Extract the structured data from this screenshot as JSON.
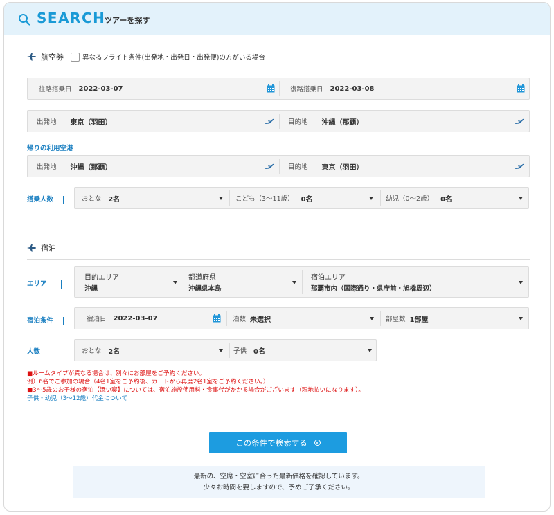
{
  "header": {
    "title": "SEARCH",
    "subtitle": "ツアーを探す"
  },
  "air": {
    "section_title": "航空券",
    "diff_flight_label": "異なるフライト条件(出発地・出発日・出発便)の方がいる場合",
    "outbound": {
      "label": "往路搭乗日",
      "value": "2022-03-07"
    },
    "inbound": {
      "label": "復路搭乗日",
      "value": "2022-03-08"
    },
    "depart": {
      "label": "出発地",
      "value": "東京（羽田）"
    },
    "dest": {
      "label": "目的地",
      "value": "沖縄（那覇）"
    },
    "return_airport_title": "帰りの利用空港",
    "ret_depart": {
      "label": "出発地",
      "value": "沖縄（那覇）"
    },
    "ret_dest": {
      "label": "目的地",
      "value": "東京（羽田）"
    },
    "pax_label": "搭乗人数",
    "adult": {
      "label": "おとな",
      "value": "2名"
    },
    "child": {
      "label": "こども（3〜11歳）",
      "value": "0名"
    },
    "infant": {
      "label": "幼児（0〜2歳）",
      "value": "0名"
    }
  },
  "hotel": {
    "section_title": "宿泊",
    "area_label": "エリア",
    "dest_area": {
      "label": "目的エリア",
      "value": "沖縄"
    },
    "prefecture": {
      "label": "都道府県",
      "value": "沖縄県本島"
    },
    "stay_area": {
      "label": "宿泊エリア",
      "value": "那覇市内（国際通り・県庁前・旭橋周辺）"
    },
    "cond_label": "宿泊条件",
    "stay_date": {
      "label": "宿泊日",
      "value": "2022-03-07"
    },
    "nights": {
      "label": "泊数",
      "value": "未選択"
    },
    "rooms": {
      "label": "部屋数",
      "value": "1部屋"
    },
    "people_label": "人数",
    "adult": {
      "label": "おとな",
      "value": "2名"
    },
    "child": {
      "label": "子供",
      "value": "0名"
    }
  },
  "notes": {
    "line1": "■ルームタイプが異なる場合は、別々にお部屋をご予約ください。",
    "line2": "例）6名でご参加の場合（4名1室をご予約後、カートから再度2名1室をご予約ください。）",
    "line3": "■3～5歳のお子様の宿泊【添い寝】については、宿泊施設使用料・食事代がかかる場合がございます（現地払いになります）。",
    "link": "子供・幼児（3～12歳）代金について"
  },
  "search_button": "この条件で検索する",
  "info": {
    "line1": "最新の、空席・空室に合った最新価格を確認しています。",
    "line2": "少々お時間を要しますので、予めご了承ください。"
  },
  "colors": {
    "accent": "#1d9ce0",
    "header_bg": "#e3f2fb",
    "note_red": "#dd1111"
  }
}
